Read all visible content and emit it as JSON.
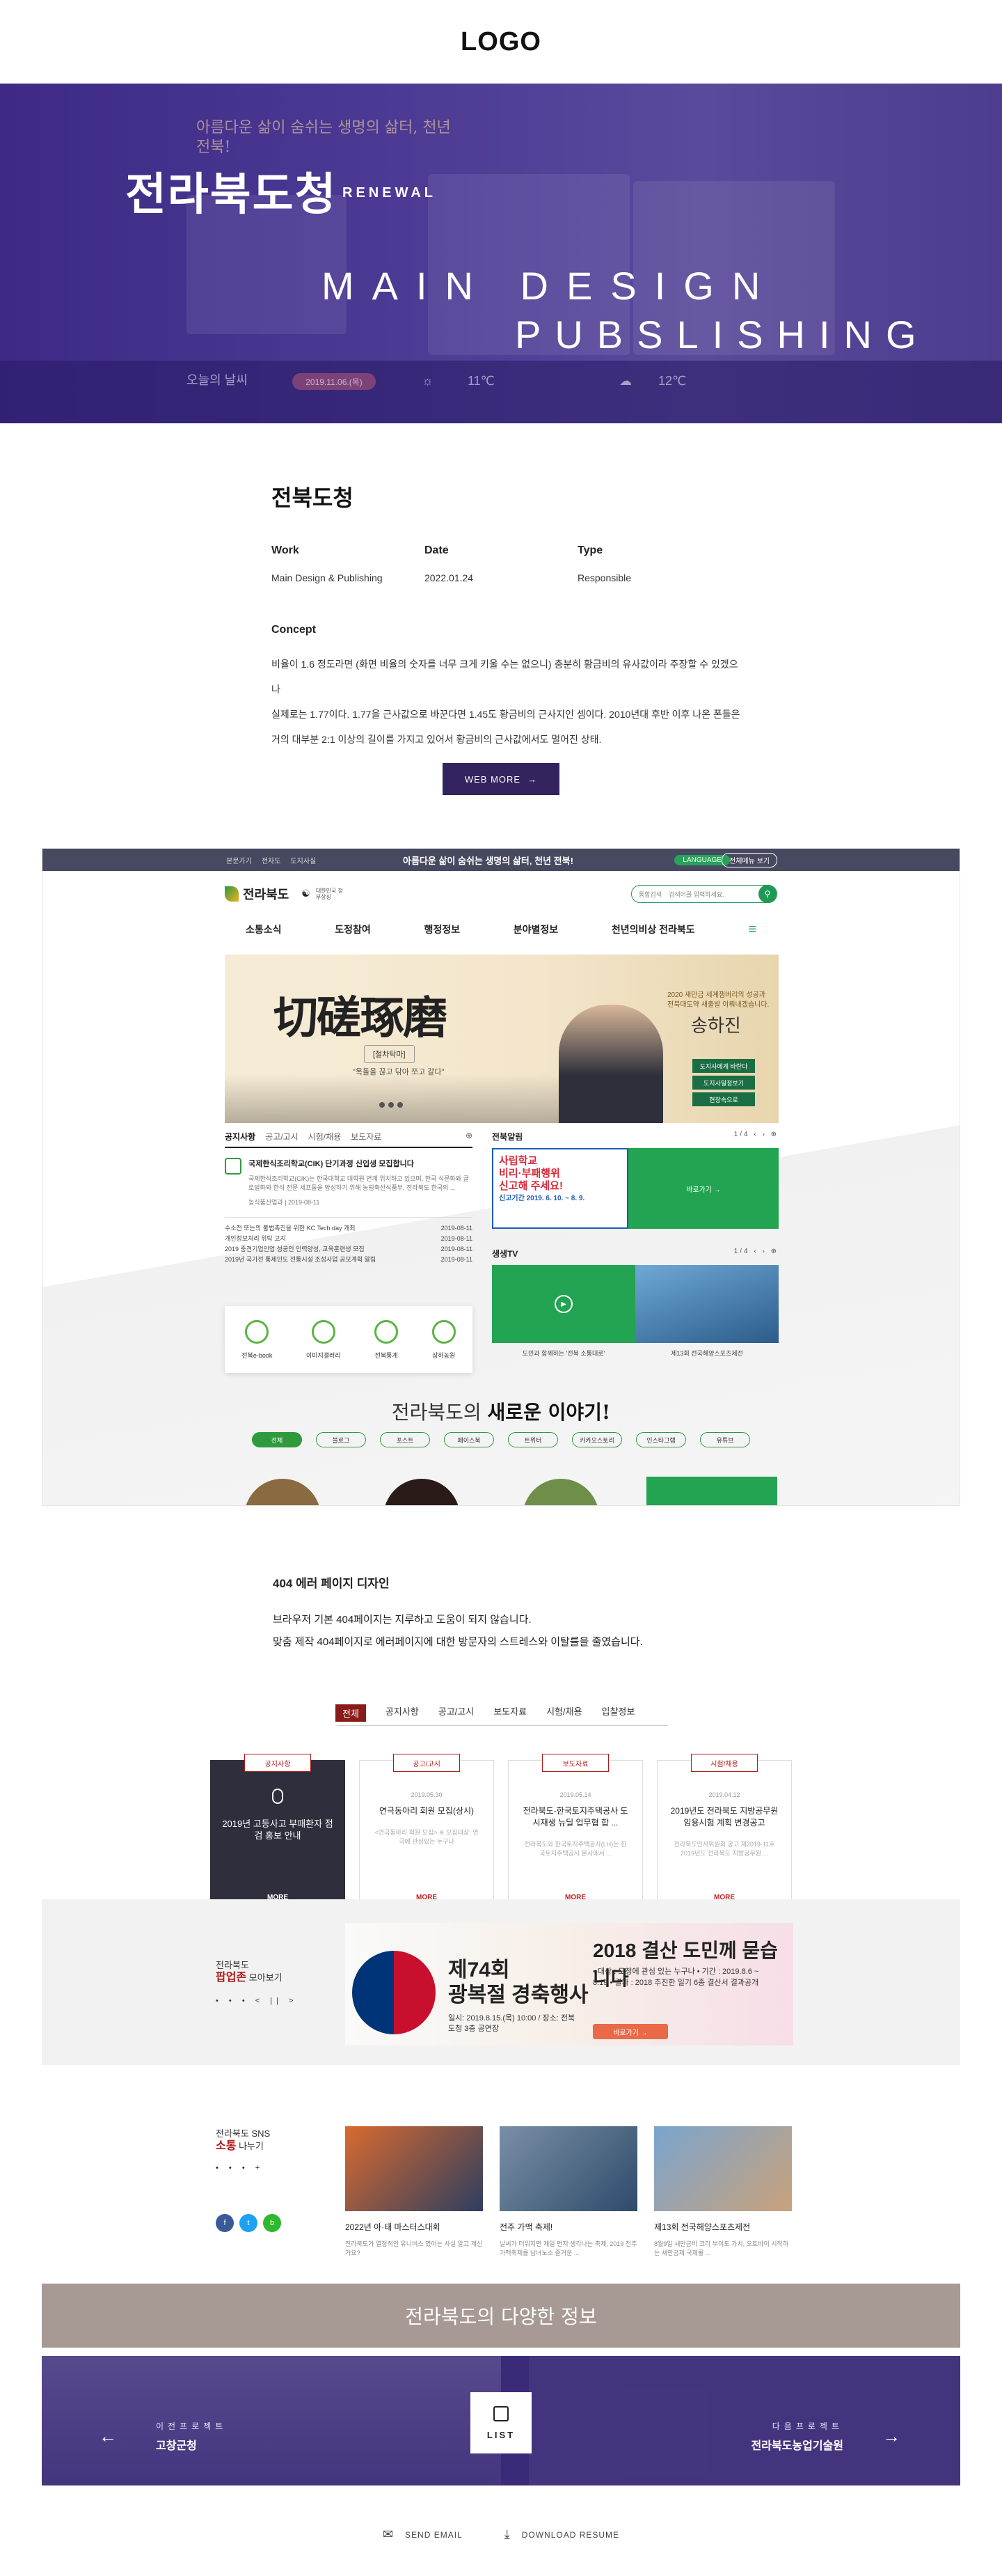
{
  "logo": "LOGO",
  "hero": {
    "title": "전라북도청",
    "renewal": "RENEWAL",
    "slogan": "아름다운 삶이 숨쉬는 생명의 삶터, 천년 전북!",
    "main_line1": "MAIN DESIGN",
    "main_line2": "PUBSLISHING",
    "weather_label": "오늘의 날씨",
    "weather_date": "2019.11.06.(목)",
    "temp1": "11℃",
    "temp2": "12℃"
  },
  "info": {
    "name": "전북도청",
    "work_label": "Work",
    "work_value": "Main Design & Publishing",
    "date_label": "Date",
    "date_value": "2022.01.24",
    "type_label": "Type",
    "type_value": "Responsible",
    "concept_label": "Concept",
    "concept_lines": [
      "비율이 1.6 정도라면 (화면 비율의 숫자를 너무 크게 키울 수는 없으니) 충분히 황금비의 유사값이라 주장할 수 있겠으나",
      "실제로는 1.77이다. 1.77을 근사값으로 바꾼다면 1.45도 황금비의 근사지인 셈이다. 2010년대 후반 이후 나온 폰들은",
      "거의 대부분 2:1 이상의 길이를 가지고 있어서 황금비의 근사값에서도 멀어진 상태."
    ],
    "web_more": "WEB MORE",
    "web_more_arrow": "→"
  },
  "mock": {
    "top_links": [
      "본문가기",
      "전자도",
      "도지사실"
    ],
    "slogan": "아름다운 삶이 숨쉬는 생명의 삶터, 천년 전북!",
    "language": "LANGUAGE",
    "all_menu": "전체메뉴 보기",
    "logo_text": "전라북도",
    "flag_label": "대한민국 정부상징",
    "search_select": "통합검색",
    "search_placeholder": "검색어를 입력하세요.",
    "nav": [
      "소통소식",
      "도정참여",
      "행정정보",
      "분야별정보",
      "천년의비상 전라북도"
    ],
    "banner": {
      "calligraphy": "切磋琢磨",
      "label": "[절차탁마]",
      "quote": "\"옥돌을 끊고 닦아 쪼고 갈다\"",
      "text": "2020 새만금 세계잼버리의 성공과 전북대도약 새출발 이뤄내겠습니다.",
      "signature": "송하진",
      "buttons": [
        "도지사에게 바란다",
        "도지사일정보기",
        "현장속으로"
      ]
    },
    "notice": {
      "tabs": [
        "공지사항",
        "공고/고시",
        "시험/채용",
        "보도자료"
      ],
      "feature_title": "국제한식조리학교(CIK) 단기과정 신입생 모집합니다",
      "feature_desc": "국제한식조리학교(CIK)는 한국대학교 대학원 연계 위치하고 있으며, 한국 식문화와 글로벌화와 한식 전문 세프들을 양성하기 위해 농림축산식품부, 전라북도 한국의 ...",
      "feature_date": "농식품산업과 | 2019-08-11",
      "items": [
        {
          "t": "수소전 또는의 불법촉진을 위한 KC Tech day 개최",
          "d": "2019-08-11"
        },
        {
          "t": "개인정보처리 위탁 고지",
          "d": "2019-08-11"
        },
        {
          "t": "2019 중견기업인업 성공인 인력양성, 교육훈련생 모집",
          "d": "2019-08-11"
        },
        {
          "t": "2019년 국가전 통제인도 전통시설 조성사업 공모계획 알림",
          "d": "2019-08-11"
        }
      ]
    },
    "quick": [
      "전북e-book",
      "이미지갤러리",
      "전북통계",
      "상하농원"
    ],
    "alert": {
      "title": "전북알림",
      "page": "1/4",
      "poster_line1": "사립학교",
      "poster_line2": "비리·부패행위",
      "poster_line3": "신고해 주세요!",
      "poster_small": "신고기간 2019. 6. 10. ~ 8. 9.",
      "link": "바로가기 →"
    },
    "tv": {
      "title": "생생TV",
      "page": "1/4",
      "captions": [
        "도민과 함께하는 '전북 소통대로'",
        "제13회 전국해양스포츠제전"
      ]
    },
    "story_prefix": "전라북도의",
    "story_bold": "새로운 이야기!",
    "chips": [
      "전체",
      "블로그",
      "포스트",
      "페이스북",
      "트위터",
      "카카오스토리",
      "인스타그램",
      "유튜브"
    ]
  },
  "s404": {
    "title": "404 에러 페이지 디자인",
    "line1": "브라우저 기본 404페이지는 지루하고 도움이 되지 않습니다.",
    "line2": "맞춤 제작 404페이지로 에러페이지에 대한 방문자의 스트레스와 이탈률을 줄였습니다."
  },
  "mock2": {
    "tabs": [
      "전체",
      "공지사항",
      "공고/고시",
      "보도자료",
      "시험/채용",
      "입찰정보"
    ],
    "cards": [
      {
        "tag": "공지사항",
        "date": "",
        "title": "2019년 고등사고 부패환자 점검 홍보 안내",
        "desc": "",
        "more": "MORE"
      },
      {
        "tag": "공고/고시",
        "date": "2019.05.30",
        "title": "연극동아리 회원 모집(상시)",
        "desc": "<연극동아리 회원 모집> ※ 모집대상: 연극에 관심있는 누구나",
        "more": "MORE"
      },
      {
        "tag": "보도자료",
        "date": "2019.05.14",
        "title": "전라북도-한국토지주택공사 도시재생 뉴딜 업무협 합 ...",
        "desc": "전라북도와 한국토지주택공사(LH)는 한국토지주택공사 본사에서 ...",
        "more": "MORE"
      },
      {
        "tag": "시험/채용",
        "date": "2019.04.12",
        "title": "2019년도 전라북도 지방공무원 임용시험 계획 변경공고",
        "desc": "전라북도인사위원회 공고 제2019-11호 2019년도 전라북도 지방공무원 ...",
        "more": "MORE"
      }
    ]
  },
  "popup": {
    "label_small": "전라북도",
    "label_bold": "팝업존",
    "label_rest": "모아보기",
    "controls": "• • •  < ||  >",
    "banner_title": "2018 결산 도민께 묻습니다",
    "banner_event_line1": "제74회",
    "banner_event_line2": "광복절 경축행사",
    "banner_event_info": "일시: 2019.8.15.(목) 10:00 / 장소: 전북도청 3층 공연장",
    "banner_details": "• 대상 : 도정에 관심 있는 누구나 • 기간 : 2019.8.6 ~ 8.19 • 결과 : 2018 추진한 일기 6종 결산서 결과공개",
    "banner_btn": "바로가기 →"
  },
  "sns": {
    "label_small": "전라북도 SNS",
    "label_bold": "소통",
    "label_rest": "나누기",
    "controls": "• • •  +",
    "posts": [
      {
        "title": "2022년 아·태 마스터스대회",
        "desc": "전라북도가 열정적인 유니버스 였어는 사실 알고 계신가요?"
      },
      {
        "title": "전주 가맥 축제!",
        "desc": "날씨가 더워지면 제일 먼저 생각나는 축제, 2019 전주가맥축제를 남녀노소 즐거운 ..."
      },
      {
        "title": "제13회 전국해양스포츠제전",
        "desc": "8월9일 새만금비 크리 부이도 가치, 오토바이 시작하는 새만금제 국제를 ..."
      }
    ]
  },
  "various": "전라북도의 다양한 정보",
  "prevnext": {
    "prev_small": "이전프로젝트",
    "prev_title": "고창군청",
    "next_small": "다음프로젝트",
    "next_title": "전라북도농업기술원",
    "list": "LIST"
  },
  "footer": {
    "send_email": "SEND EMAIL",
    "download": "DOWNLOAD RESUME"
  }
}
